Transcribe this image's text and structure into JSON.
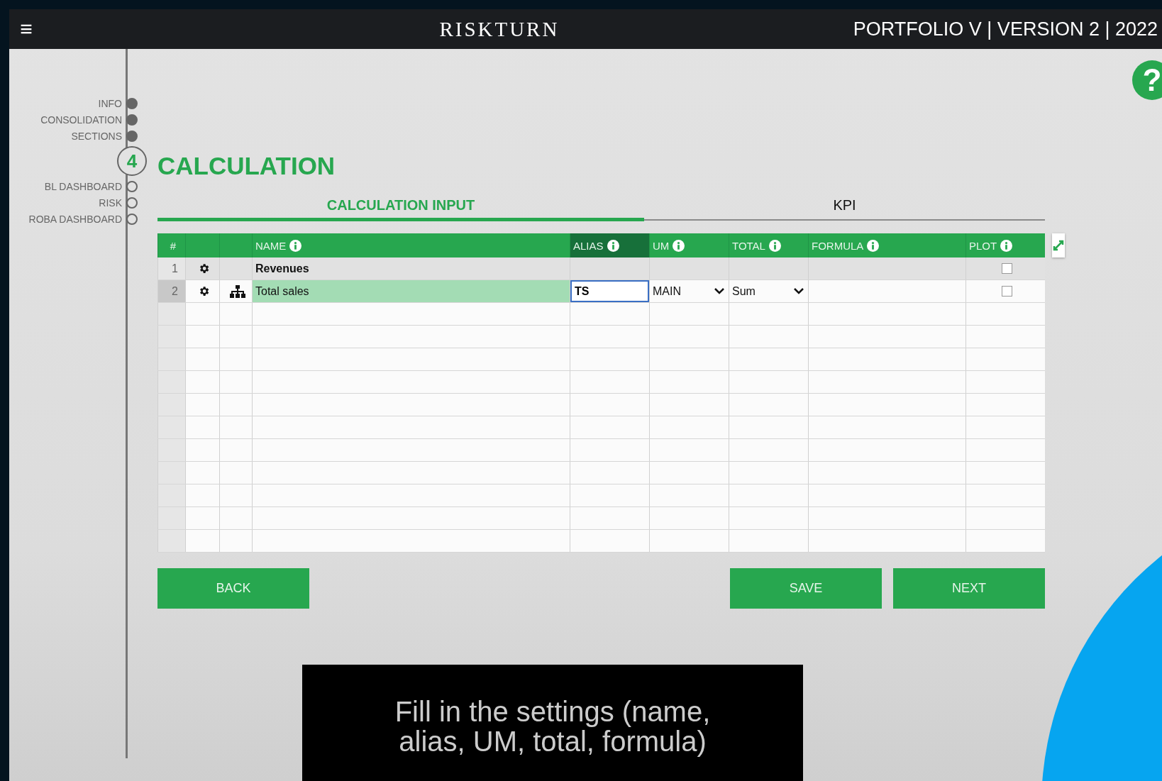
{
  "topbar": {
    "menu_glyph": "≡",
    "logo": "RISKTURN",
    "title": "PORTFOLIO V | VERSION 2 | 2022"
  },
  "help_glyph": "?",
  "steps": [
    {
      "label": "INFO",
      "kind": "step",
      "completed": true
    },
    {
      "label": "CONSOLIDATION",
      "kind": "step",
      "completed": true
    },
    {
      "label": "SECTIONS",
      "kind": "step",
      "completed": true
    },
    {
      "label": "4",
      "kind": "current"
    },
    {
      "label": "BL DASHBOARD",
      "kind": "step",
      "completed": false
    },
    {
      "label": "RISK",
      "kind": "step",
      "completed": false
    },
    {
      "label": "ROBA DASHBOARD",
      "kind": "step",
      "completed": false
    }
  ],
  "page_title": "CALCULATION",
  "tabs": [
    {
      "label": "CALCULATION INPUT",
      "selected": true
    },
    {
      "label": "KPI",
      "selected": false
    }
  ],
  "table": {
    "columns": [
      {
        "label": "#",
        "info": false,
        "active": false
      },
      {
        "info": false,
        "active": false
      },
      {
        "info": false,
        "active": false
      },
      {
        "label": "NAME",
        "info": true,
        "active": false
      },
      {
        "label": "ALIAS",
        "info": true,
        "active": true
      },
      {
        "label": "UM",
        "info": true,
        "active": false
      },
      {
        "label": "TOTAL",
        "info": true,
        "active": false
      },
      {
        "label": "FORMULA",
        "info": true,
        "active": false
      },
      {
        "label": "PLOT",
        "info": true,
        "active": false
      }
    ],
    "rows": [
      {
        "number": "1",
        "kind": "group",
        "selected": false,
        "name": "Revenues",
        "plot_checked": false
      },
      {
        "number": "2",
        "kind": "item",
        "selected": true,
        "name": "Total sales",
        "alias": "TS",
        "um": "MAIN",
        "total": "Sum",
        "plot_checked": false
      }
    ]
  },
  "buttons": {
    "left": [
      "BACK"
    ],
    "right": [
      "SAVE",
      "NEXT"
    ]
  },
  "caption": "Fill in the settings (name,\nalias, UM, total, formula)"
}
